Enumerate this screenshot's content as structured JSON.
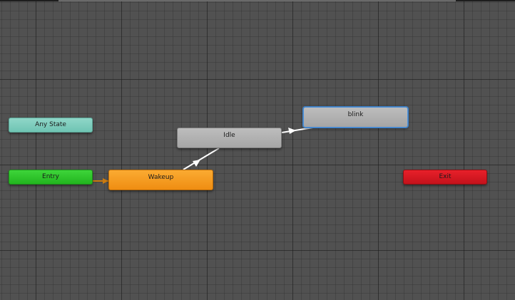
{
  "states": {
    "any_state": {
      "label": "Any State",
      "color": "#7fcdbd"
    },
    "entry": {
      "label": "Entry",
      "color": "#2fc52b"
    },
    "exit": {
      "label": "Exit",
      "color": "#d8161f"
    },
    "wakeup": {
      "label": "Wakeup",
      "color": "#f59a22",
      "role": "default-state"
    },
    "idle": {
      "label": "Idle",
      "color": "#b1b1b1"
    },
    "blink": {
      "label": "blink",
      "color": "#b1b1b1",
      "selected": true,
      "selection_color": "#4d8fd6"
    }
  },
  "transitions": [
    {
      "from": "Entry",
      "to": "Wakeup",
      "color": "#c97a10"
    },
    {
      "from": "Wakeup",
      "to": "Idle",
      "color": "#ffffff"
    },
    {
      "from": "Idle",
      "to": "blink",
      "color": "#ffffff"
    }
  ],
  "canvas": {
    "background": "#515151",
    "grid": true
  }
}
